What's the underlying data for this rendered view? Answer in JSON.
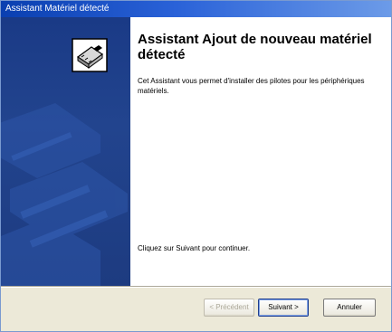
{
  "window": {
    "title": "Assistant Matériel détecté"
  },
  "content": {
    "heading": "Assistant Ajout de nouveau matériel détecté",
    "intro": "Cet Assistant vous permet d'installer des pilotes pour les périphériques matériels.",
    "continue_text": "Cliquez sur Suivant pour continuer."
  },
  "buttons": {
    "back_label": "< Précédent",
    "next_label": "Suivant >",
    "cancel_label": "Annuler"
  },
  "side_panel": {
    "icon": "hardware-card-icon"
  },
  "colors": {
    "title_bar": "#0a3fb0",
    "side_panel": "#1d3b80",
    "dialog_background": "#ece9d8"
  }
}
